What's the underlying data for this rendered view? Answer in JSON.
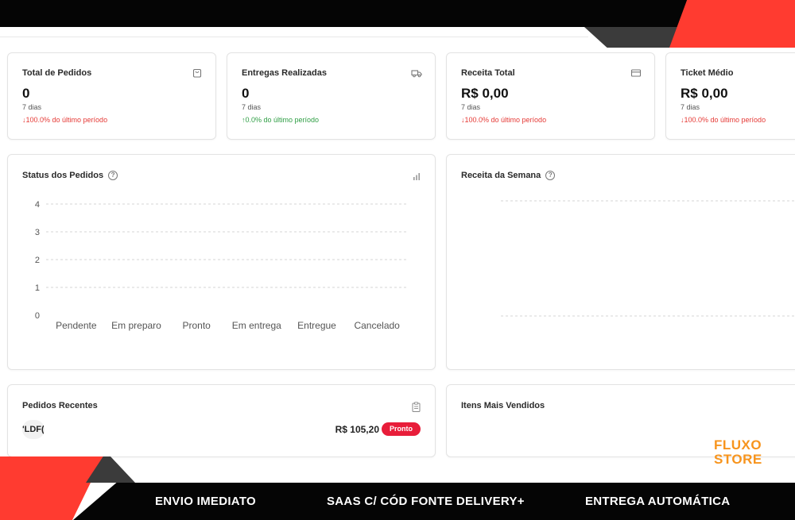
{
  "stats": [
    {
      "title": "Total de Pedidos",
      "icon": "bag-icon",
      "value": "0",
      "period": "7 dias",
      "delta": "↓100.0% do último período",
      "trend": "down"
    },
    {
      "title": "Entregas Realizadas",
      "icon": "truck-icon",
      "value": "0",
      "period": "7 dias",
      "delta": "↑0.0% do último período",
      "trend": "up"
    },
    {
      "title": "Receita Total",
      "icon": "credit-card-icon",
      "value": "R$ 0,00",
      "period": "7 dias",
      "delta": "↓100.0% do último período",
      "trend": "down"
    },
    {
      "title": "Ticket Médio",
      "value": "R$ 0,00",
      "period": "7 dias",
      "delta": "↓100.0% do último período",
      "trend": "down"
    }
  ],
  "status_panel": {
    "title": "Status dos Pedidos",
    "icon": "bar-chart-icon"
  },
  "revenue_panel": {
    "title": "Receita da Semana"
  },
  "recent_orders": {
    "title": "Pedidos Recentes",
    "icon": "clipboard-icon",
    "order": {
      "avatar_text": "'LDF(",
      "price": "R$ 105,20",
      "status": "Pronto"
    }
  },
  "top_items": {
    "title": "Itens Mais Vendidos"
  },
  "brand": {
    "line1": "FLUXO",
    "line2": "STORE"
  },
  "banner": {
    "item1": "ENVIO IMEDIATO",
    "item2": "SAAS C/ CÓD FONTE DELIVERY+",
    "item3": "ENTREGA AUTOMÁTICA"
  },
  "colors": {
    "accent_red": "#ff3b30",
    "badge_red": "#e81d3a",
    "brand_orange": "#f7941d",
    "negative": "#e53935",
    "positive": "#2e9e44"
  },
  "chart_data": {
    "type": "bar",
    "categories": [
      "Pendente",
      "Em preparo",
      "Pronto",
      "Em entrega",
      "Entregue",
      "Cancelado"
    ],
    "values": [
      0,
      0,
      0,
      0,
      0,
      0
    ],
    "yticks": [
      "0",
      "1",
      "2",
      "3",
      "4"
    ],
    "ylim": [
      0,
      4
    ],
    "grid": true
  }
}
